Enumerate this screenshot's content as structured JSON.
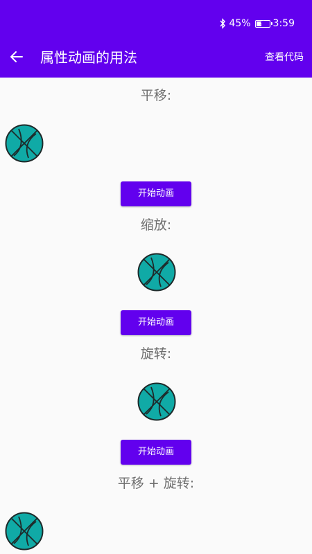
{
  "status_bar": {
    "battery_percent_text": "45%",
    "battery_level": 0.45,
    "time": "3:59",
    "icons": [
      "bluetooth-icon",
      "battery-charging-icon"
    ]
  },
  "app_bar": {
    "back_icon": "arrow-left-icon",
    "title": "属性动画的用法",
    "action_label": "查看代码"
  },
  "sections": [
    {
      "label": "平移:",
      "button_label": "开始动画"
    },
    {
      "label": "缩放:",
      "button_label": "开始动画"
    },
    {
      "label": "旋转:",
      "button_label": "开始动画"
    },
    {
      "label": "平移 + 旋转:"
    }
  ],
  "colors": {
    "primary": "#6200ee",
    "ball_fill": "#10aaa6",
    "ball_line": "#1e2a2a",
    "label_text": "#6e6e6e",
    "background": "#fafafa"
  }
}
